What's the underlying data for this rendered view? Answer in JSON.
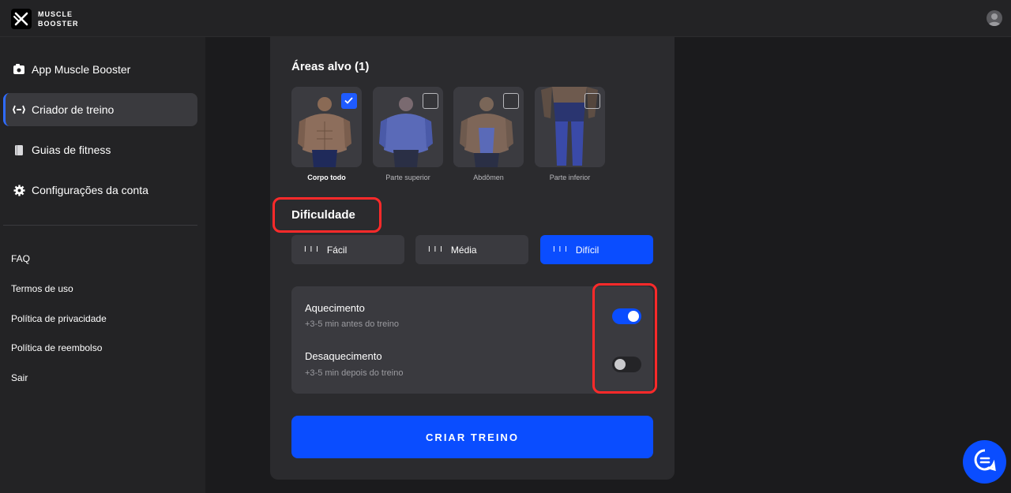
{
  "brand": {
    "line1": "MUSCLE",
    "line2": "BOOSTER"
  },
  "sidebar": {
    "items": [
      {
        "label": "App Muscle Booster",
        "icon": "app-icon"
      },
      {
        "label": "Criador de treino",
        "icon": "dumbbell-icon",
        "active": true
      },
      {
        "label": "Guias de fitness",
        "icon": "book-icon"
      },
      {
        "label": "Configurações da conta",
        "icon": "gear-icon"
      }
    ],
    "links": [
      "FAQ",
      "Termos de uso",
      "Política de privacidade",
      "Política de reembolso",
      "Sair"
    ]
  },
  "builder": {
    "areas_title": "Áreas alvo (1)",
    "areas": [
      {
        "label": "Corpo todo",
        "checked": true
      },
      {
        "label": "Parte superior",
        "checked": false
      },
      {
        "label": "Abdômen",
        "checked": false
      },
      {
        "label": "Parte inferior",
        "checked": false
      }
    ],
    "difficulty_title": "Dificuldade",
    "difficulties": [
      {
        "label": "Fácil",
        "selected": false
      },
      {
        "label": "Média",
        "selected": false
      },
      {
        "label": "Difícil",
        "selected": true
      }
    ],
    "warmup": {
      "title": "Aquecimento",
      "subtitle": "+3-5 min antes do treino",
      "on": true
    },
    "cooldown": {
      "title": "Desaquecimento",
      "subtitle": "+3-5 min depois do treino",
      "on": false
    },
    "create_label": "CRIAR TREINO"
  },
  "colors": {
    "accent": "#0a4dff",
    "highlight": "#ff2a2a",
    "card": "#2b2b2e"
  }
}
